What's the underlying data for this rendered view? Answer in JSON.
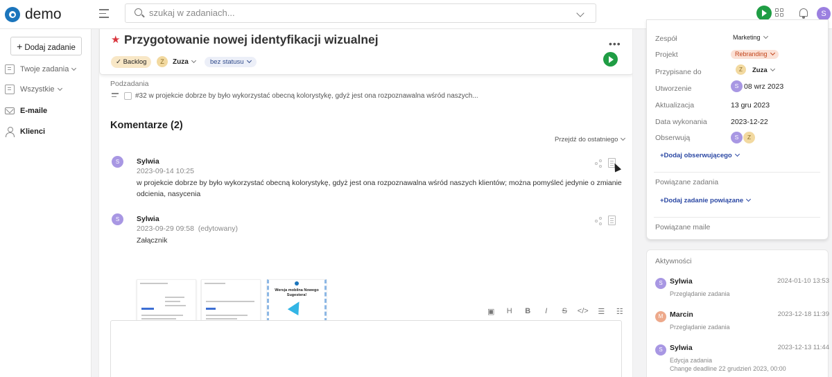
{
  "app": {
    "name": "demo"
  },
  "search": {
    "placeholder": "szukaj w zadaniach..."
  },
  "user_avatar": "S",
  "sidebar": {
    "add_label": "Dodaj zadanie",
    "items": [
      {
        "label": "Twoje zadania",
        "icon": "document-icon"
      },
      {
        "label": "Wszystkie",
        "icon": "document-icon"
      },
      {
        "label": "E-maile",
        "icon": "mail-icon"
      },
      {
        "label": "Klienci",
        "icon": "user-icon"
      }
    ]
  },
  "task": {
    "title": "Przygotowanie nowej identyfikacji wizualnej",
    "backlog_label": "✓ Backlog",
    "assignee_initial": "Z",
    "assignee": "Zuza",
    "status": "bez statusu",
    "subtasks_label": "Podzadania",
    "subtask": "#32 w projekcie dobrze by było wykorzystać obecną kolorystykę, gdyż jest ona rozpoznawalna wśród naszych..."
  },
  "comments": {
    "title": "Komentarze (2)",
    "jump_label": "Przejdź do ostatniego",
    "items": [
      {
        "initial": "S",
        "author": "Sylwia",
        "date": "2023-09-14 10:25",
        "text": "w projekcie dobrze by było wykorzystać obecną kolorystykę, gdyż jest ona rozpoznawalna wśród naszych klientów; można pomyśleć jedynie o zmianie odcienia, nasycenia"
      },
      {
        "initial": "S",
        "author": "Sylwia",
        "date": "2023-09-29 09:58",
        "edited": "(edytowany)",
        "text": "Załącznik"
      }
    ],
    "attachment_text": "Wersja mobilna Nowego Sugestera!"
  },
  "properties": {
    "team_label": "Zespół",
    "team": "Marketing",
    "project_label": "Projekt",
    "project": "Rebranding",
    "assigned_label": "Przypisane do",
    "assigned_initial": "Z",
    "assigned": "Zuza",
    "created_label": "Utworzenie",
    "created_initial": "S",
    "created": "08 wrz 2023",
    "updated_label": "Aktualizacja",
    "updated": "13 gru 2023",
    "due_label": "Data wykonania",
    "due": "2023-12-22",
    "watchers_label": "Obserwują",
    "watcher1": "S",
    "watcher2": "Z",
    "add_watcher": "+Dodaj obserwującego",
    "related_label": "Powiązane zadania",
    "add_related": "+Dodaj zadanie powiązane",
    "related_mail_label": "Powiązane maile"
  },
  "activity": {
    "title": "Aktywności",
    "items": [
      {
        "initial": "S",
        "name": "Sylwia",
        "date": "2024-01-10 13:53",
        "desc": "Przeglądanie zadania",
        "desc2": ""
      },
      {
        "initial": "M",
        "name": "Marcin",
        "date": "2023-12-18 11:39",
        "desc": "Przeglądanie zadania",
        "desc2": ""
      },
      {
        "initial": "S",
        "name": "Sylwia",
        "date": "2023-12-13 11:44",
        "desc": "Edycja zadania",
        "desc2": "Change deadline 22 grudzień 2023, 00:00"
      }
    ]
  },
  "colors": {
    "accent_green": "#1f9d44",
    "star_red": "#d9363e",
    "link_blue": "#2a47a3"
  }
}
